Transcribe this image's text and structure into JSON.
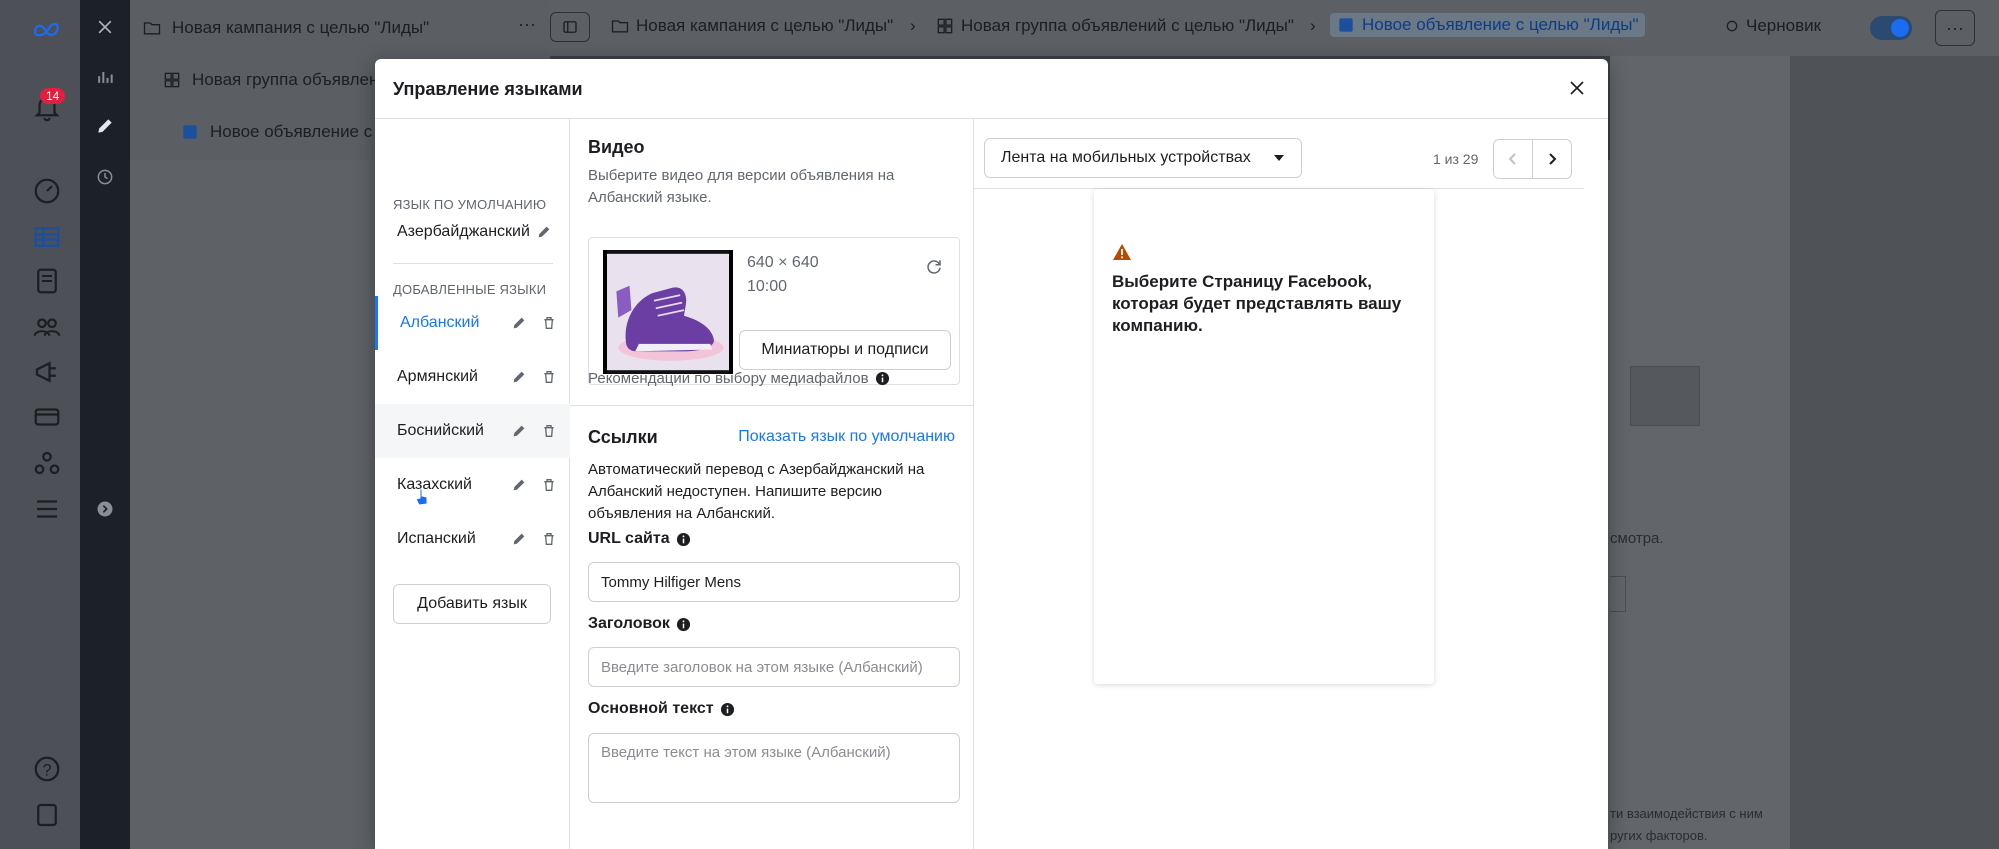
{
  "app": {
    "notification_count": "14",
    "tree": {
      "campaign": "Новая кампания с целью \"Лиды\"",
      "adset": "Новая группа объявлени",
      "ad": "Новое объявление с ц"
    },
    "breadcrumbs": [
      "Новая кампания с целью \"Лиды\"",
      "Новая группа объявлений с целью \"Лиды\"",
      "Новое объявление с целью \"Лиды\""
    ],
    "status": "Черновик",
    "bg_text_1": "смотра.",
    "bg_text_2": "ти взаимодействия с ним",
    "bg_text_3": "ругих факторов."
  },
  "modal": {
    "title": "Управление языками",
    "default_language_label": "ЯЗЫК ПО УМОЛЧАНИЮ",
    "default_language": "Азербайджанский",
    "added_languages_label": "ДОБАВЛЕННЫЕ ЯЗЫКИ",
    "languages": [
      {
        "label": "Албанский",
        "selected": true
      },
      {
        "label": "Армянский",
        "selected": false
      },
      {
        "label": "Боснийский",
        "selected": false
      },
      {
        "label": "Казахский",
        "selected": false
      },
      {
        "label": "Испанский",
        "selected": false
      }
    ],
    "add_language_button": "Добавить язык"
  },
  "editor": {
    "video_heading": "Видео",
    "video_desc": "Выберите видео для версии объявления на Албанский языке.",
    "media_dimensions": "640 × 640",
    "media_duration": "10:00",
    "thumbnails_button": "Миниатюры и подписи",
    "media_recommendations": "Рекомендации по выбору медиафайлов",
    "links_heading": "Ссылки",
    "show_default_link": "Показать язык по умолчанию",
    "auto_translate_note": "Автоматический перевод с Азербайджанский на Албанский недоступен. Напишите версию объявления на Албанский.",
    "url_label": "URL сайта",
    "url_value": "Tommy Hilfiger Mens",
    "headline_label": "Заголовок",
    "headline_placeholder": "Введите заголовок на этом языке (Албанский)",
    "body_label": "Основной текст",
    "body_placeholder": "Введите текст на этом языке (Албанский)"
  },
  "preview": {
    "placement": "Лента на мобильных устройствах",
    "pager": "1 из 29",
    "warning": "Выберите Страницу Facebook, которая будет представлять вашу компанию."
  },
  "colors": {
    "accent": "#1877f2",
    "warning": "#b84b00"
  }
}
